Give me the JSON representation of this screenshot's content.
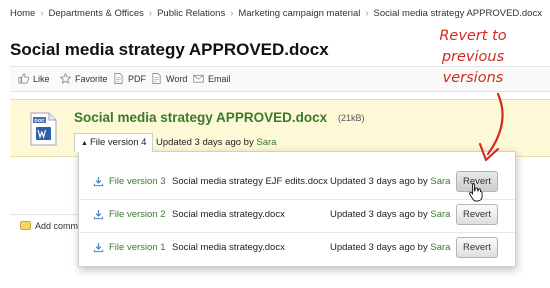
{
  "breadcrumb": {
    "items": [
      "Home",
      "Departments & Offices",
      "Public Relations",
      "Marketing campaign material",
      "Social media strategy APPROVED.docx"
    ],
    "separator": "›"
  },
  "page_title": "Social media strategy APPROVED.docx",
  "toolbar": {
    "like": "Like",
    "favorite": "Favorite",
    "pdf": "PDF",
    "word": "Word",
    "email": "Email"
  },
  "document": {
    "title": "Social media strategy APPROVED.docx",
    "size": "(21kB)",
    "icon_label": "DOC"
  },
  "current_version": {
    "tab_label": "File version 4",
    "updated_prefix": "Updated 3 days ago by",
    "author": "Sara"
  },
  "versions": [
    {
      "label": "File version 3",
      "file": "Social media strategy EJF edits.docx",
      "updated_prefix": "Updated 3 days ago by",
      "author": "Sara",
      "button": "Revert"
    },
    {
      "label": "File version 2",
      "file": "Social media strategy.docx",
      "updated_prefix": "Updated 3 days ago by",
      "author": "Sara",
      "button": "Revert"
    },
    {
      "label": "File version 1",
      "file": "Social media strategy.docx",
      "updated_prefix": "Updated 3 days ago by",
      "author": "Sara",
      "button": "Revert"
    }
  ],
  "add_comment": "Add comment",
  "annotation": {
    "lines": [
      "Revert to",
      "previous",
      "versions"
    ],
    "color": "#d52b1e"
  },
  "colors": {
    "link_green": "#3a7a2c",
    "panel_yellow": "#fdf8d6"
  }
}
